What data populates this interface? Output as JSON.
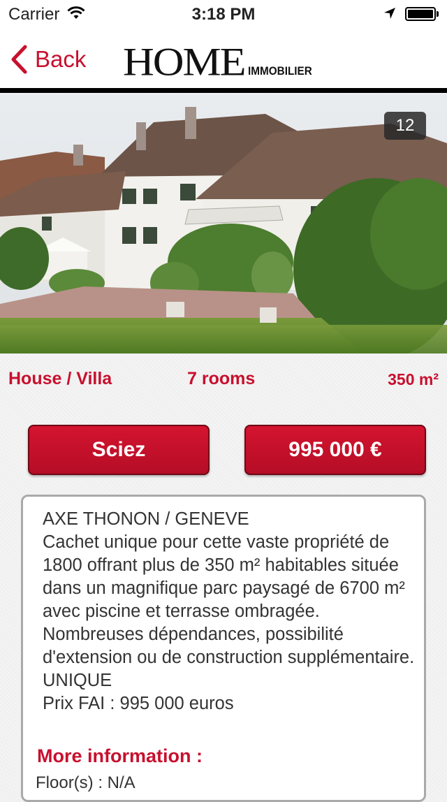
{
  "status_bar": {
    "carrier": "Carrier",
    "time": "3:18 PM"
  },
  "nav": {
    "back_label": "Back",
    "logo_main": "HOME",
    "logo_sub": "IMMOBILIER"
  },
  "photo": {
    "count": "12"
  },
  "listing": {
    "type": "House / Villa",
    "rooms": "7  rooms",
    "area": "350 m²",
    "city": "Sciez",
    "price": "995 000 €",
    "description": "AXE THONON / GENEVE\nCachet unique pour cette vaste propriété de 1800 offrant plus de 350 m² habitables située dans un magnifique parc paysagé de 6700 m² avec piscine et terrasse ombragée. Nombreuses dépendances, possibilité d'extension ou de construction supplémentaire.\nUNIQUE\nPrix FAI : 995 000 euros",
    "more_info_label": "More information :",
    "floors": "Floor(s) : N/A"
  },
  "colors": {
    "accent": "#c8102e"
  }
}
